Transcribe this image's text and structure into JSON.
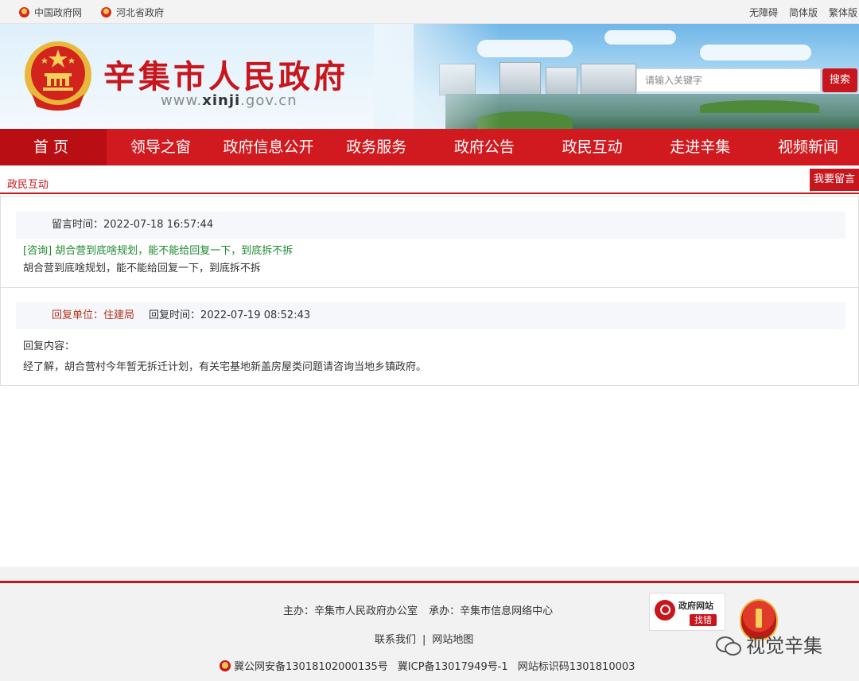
{
  "topbar": {
    "left_links": [
      "中国政府网",
      "河北省政府"
    ],
    "right_links": [
      "无障碍",
      "简体版",
      "繁体版"
    ]
  },
  "header": {
    "title": "辛集市人民政府",
    "url_prefix": "www.",
    "url_domain": "xinji",
    "url_suffix": ".gov.cn",
    "search_placeholder": "请输入关键字",
    "search_button": "搜索"
  },
  "nav": {
    "items": [
      "首页",
      "领导之窗",
      "政府信息公开",
      "政务服务",
      "政府公告",
      "政民互动",
      "走进辛集",
      "视频新闻"
    ]
  },
  "breadcrumb": {
    "current": "政民互动",
    "leave_message_button": "我要留言"
  },
  "message": {
    "time_label": "留言时间：",
    "time_value": "2022-07-18 16:57:44",
    "title": "[咨询] 胡合营到底啥规划，能不能给回复一下，到底拆不拆",
    "body": "胡合营到底啥规划，能不能给回复一下，到底拆不拆"
  },
  "reply": {
    "unit_label": "回复单位：",
    "unit_value": "住建局",
    "time_label": "回复时间：",
    "time_value": "2022-07-19 08:52:43",
    "content_label": "回复内容：",
    "content": "经了解，胡合营村今年暂无拆迁计划，有关宅基地新盖房屋类问题请咨询当地乡镇政府。"
  },
  "footer": {
    "host": "主办：辛集市人民政府办公室",
    "undertake": "承办：辛集市信息网络中心",
    "contact": "联系我们",
    "separator": "|",
    "sitemap": "网站地图",
    "police": "冀公网安备13018102000135号",
    "icp": "冀ICP备13017949号-1",
    "site_code": "网站标识码1301810003",
    "find_error_title": "政府网站",
    "find_error_action": "找错"
  },
  "watermark": {
    "text": "视觉辛集"
  },
  "colors": {
    "brand_red": "#c8161d",
    "nav_red": "#d11a1f",
    "question_green": "#1e8a2e"
  }
}
